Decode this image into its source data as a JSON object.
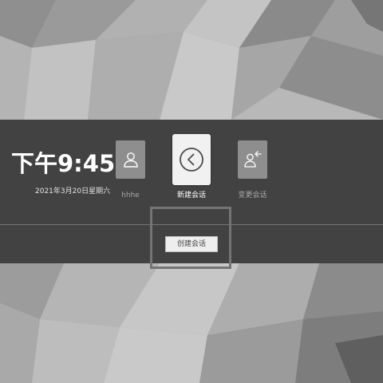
{
  "clock": {
    "time": "下午9:45",
    "date": "2021年3月20日星期六"
  },
  "sessions": {
    "user": {
      "label": "hhhe",
      "icon": "user-icon"
    },
    "new_session": {
      "label": "新建会话",
      "icon": "chevron-left-circle-icon",
      "selected": true
    },
    "switch_session": {
      "label": "变更会话",
      "icon": "user-switch-icon"
    }
  },
  "action": {
    "create_button_label": "创建会话"
  },
  "colors": {
    "band": "#3a3a3a",
    "tile": "#8e8e8e",
    "selected_tile": "#f1f1f1",
    "text_primary": "#ffffff",
    "text_muted": "#a9a9a9"
  }
}
